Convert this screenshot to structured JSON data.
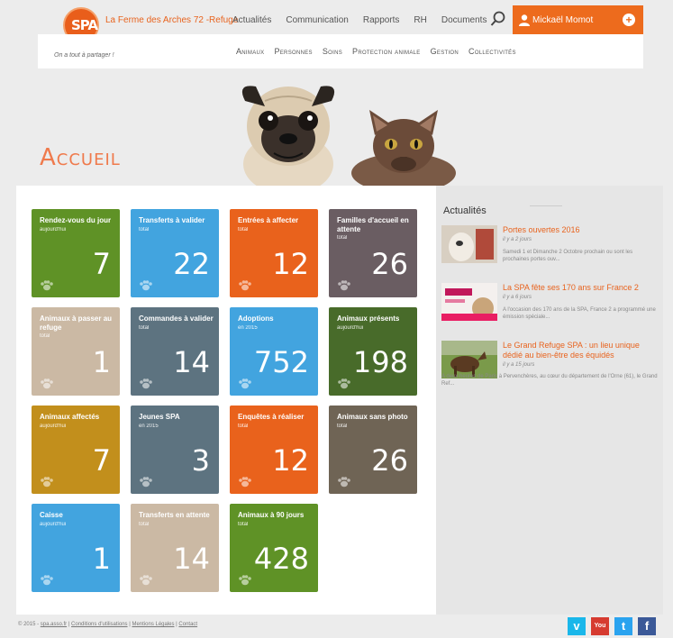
{
  "header": {
    "site_title": "La Ferme des Arches 72 -Refuge",
    "nav": [
      "Actualités",
      "Communication",
      "Rapports",
      "RH",
      "Documents"
    ],
    "user_name": "Mickaël Momot",
    "user_add": "+",
    "tagline": "On a tout à partager !",
    "sub_nav": [
      "Animaux",
      "Personnes",
      "Soins",
      "Protection animale",
      "Gestion",
      "Collectivités"
    ],
    "colors": {
      "accent": "#ed6b1d",
      "title": "#ef7a4c"
    }
  },
  "page": {
    "title": "Accueil"
  },
  "tiles": [
    {
      "label": "Rendez-vous du jour",
      "sub": "aujourd'hui",
      "value": "7",
      "color": "#5f9226"
    },
    {
      "label": "Transferts à valider",
      "sub": "total",
      "value": "22",
      "color": "#42a4df"
    },
    {
      "label": "Entrées à affecter",
      "sub": "total",
      "value": "12",
      "color": "#e9621c"
    },
    {
      "label": "Familles d'accueil en attente",
      "sub": "total",
      "value": "26",
      "color": "#6a5d62"
    },
    {
      "label": "Animaux à passer au refuge",
      "sub": "total",
      "value": "1",
      "color": "#cbb9a4"
    },
    {
      "label": "Commandes à valider",
      "sub": "total",
      "value": "14",
      "color": "#5d7380"
    },
    {
      "label": "Adoptions",
      "sub": "en 2015",
      "value": "752",
      "color": "#42a4df"
    },
    {
      "label": "Animaux présents",
      "sub": "aujourd'hui",
      "value": "198",
      "color": "#486b2a"
    },
    {
      "label": "Animaux affectés",
      "sub": "aujourd'hui",
      "value": "7",
      "color": "#c28f1c"
    },
    {
      "label": "Jeunes SPA",
      "sub": "en 2015",
      "value": "3",
      "color": "#5d7380"
    },
    {
      "label": "Enquêtes à réaliser",
      "sub": "total",
      "value": "12",
      "color": "#e9621c"
    },
    {
      "label": "Animaux sans photo",
      "sub": "total",
      "value": "26",
      "color": "#6f6455"
    },
    {
      "label": "Caisse",
      "sub": "aujourd'hui",
      "value": "1",
      "color": "#42a4df"
    },
    {
      "label": "Transferts en attente",
      "sub": "total",
      "value": "14",
      "color": "#cbb9a4"
    },
    {
      "label": "Animaux à 90 jours",
      "sub": "total",
      "value": "428",
      "color": "#5f9226"
    }
  ],
  "news": {
    "title": "Actualités",
    "items": [
      {
        "title": "Portes ouvertes 2016",
        "date": "il y a 2 jours",
        "text": "Samedi 1 et Dimanche 2 Octobre prochain ou sont les prochaines portes ouv..."
      },
      {
        "title": "La SPA fête ses 170 ans sur France 2",
        "date": "il y a 6 jours",
        "text": "A l'occasion des 170 ans de la SPA, France 2 a programmé une émission spéciale..."
      },
      {
        "title": "Le Grand Refuge SPA : un lieu unique dédié au bien-être des équidés",
        "date": "il y a 15 jours",
        "text": "A deux heures de Paris à Pervenchères, au cœur du département de l'Orne (61), le Grand Ref..."
      }
    ]
  },
  "footer": {
    "copyright": "© 2015 -",
    "links": [
      "spa.asso.fr",
      "Conditions d'utilisations",
      "Mentions Légales",
      "Contact"
    ],
    "social": [
      {
        "name": "vimeo",
        "glyph": "v",
        "color": "#1ab7ea"
      },
      {
        "name": "youtube",
        "glyph": "You",
        "color": "#d63b30"
      },
      {
        "name": "twitter",
        "glyph": "t",
        "color": "#2aa3ef"
      },
      {
        "name": "facebook",
        "glyph": "f",
        "color": "#3b5998"
      }
    ]
  }
}
